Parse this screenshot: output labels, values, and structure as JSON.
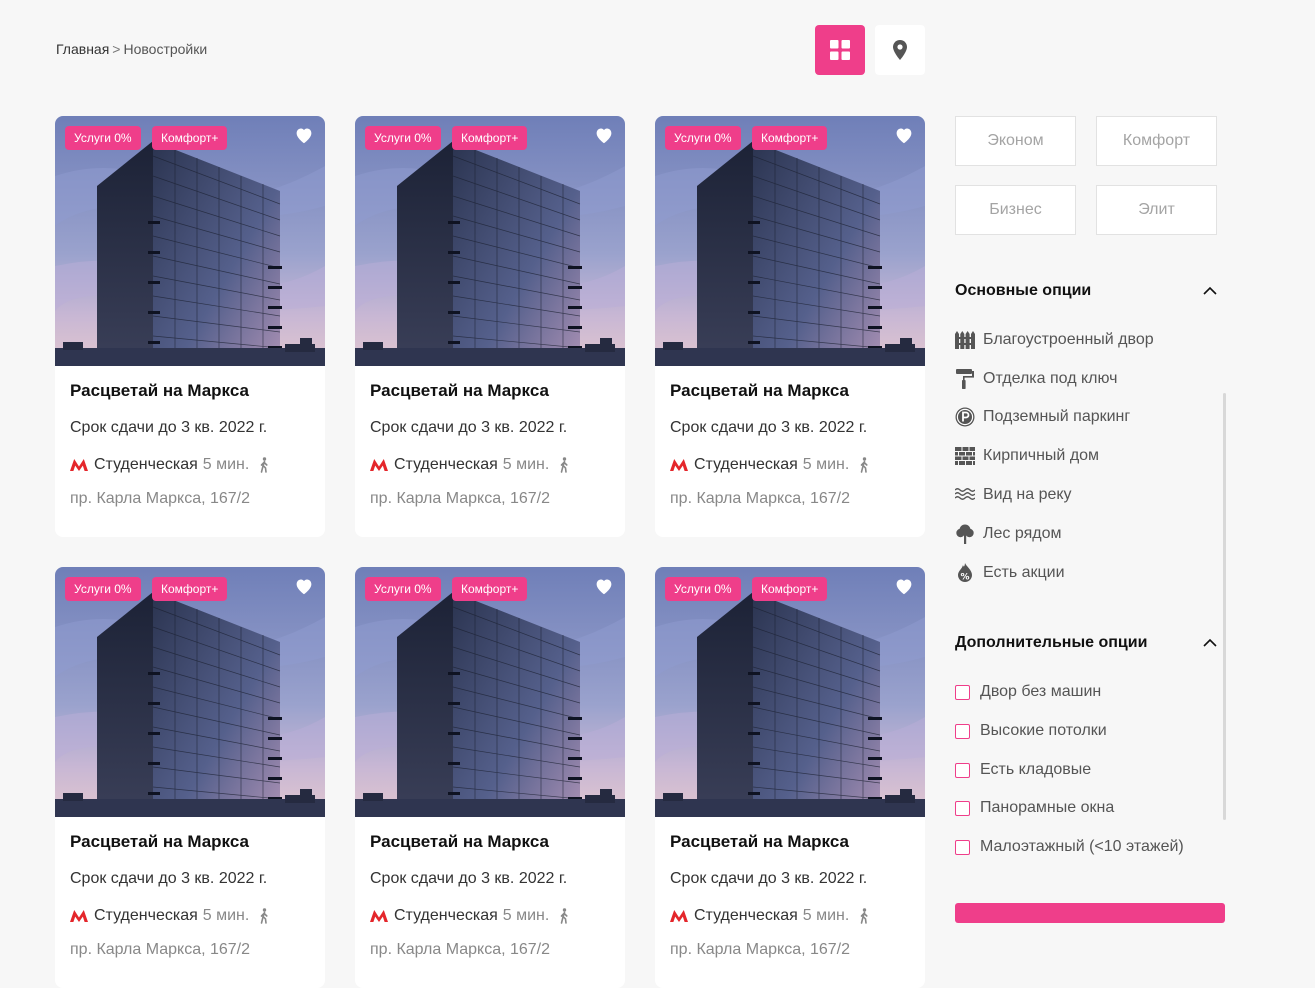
{
  "breadcrumb": {
    "home": "Главная",
    "separator": ">",
    "current": "Новостройки"
  },
  "view_toggle": {
    "grid_icon": "grid-icon",
    "map_icon": "map-pin-icon"
  },
  "colors": {
    "accent": "#ef3e8a",
    "metro": "#e4262b"
  },
  "cards": [
    {
      "tags": [
        "Услуги 0%",
        "Комфорт+"
      ],
      "title": "Расцветай на Маркса",
      "deadline": "Срок сдачи до 3 кв. 2022 г.",
      "metro": "Студенческая",
      "metro_time": "5 мин.",
      "address": "пр. Карла Маркса, 167/2"
    },
    {
      "tags": [
        "Услуги 0%",
        "Комфорт+"
      ],
      "title": "Расцветай на Маркса",
      "deadline": "Срок сдачи до 3 кв. 2022 г.",
      "metro": "Студенческая",
      "metro_time": "5 мин.",
      "address": "пр. Карла Маркса, 167/2"
    },
    {
      "tags": [
        "Услуги 0%",
        "Комфорт+"
      ],
      "title": "Расцветай на Маркса",
      "deadline": "Срок сдачи до 3 кв. 2022 г.",
      "metro": "Студенческая",
      "metro_time": "5 мин.",
      "address": "пр. Карла Маркса, 167/2"
    },
    {
      "tags": [
        "Услуги 0%",
        "Комфорт+"
      ],
      "title": "Расцветай на Маркса",
      "deadline": "Срок сдачи до 3 кв. 2022 г.",
      "metro": "Студенческая",
      "metro_time": "5 мин.",
      "address": "пр. Карла Маркса, 167/2"
    },
    {
      "tags": [
        "Услуги 0%",
        "Комфорт+"
      ],
      "title": "Расцветай на Маркса",
      "deadline": "Срок сдачи до 3 кв. 2022 г.",
      "metro": "Студенческая",
      "metro_time": "5 мин.",
      "address": "пр. Карла Маркса, 167/2"
    },
    {
      "tags": [
        "Услуги 0%",
        "Комфорт+"
      ],
      "title": "Расцветай на Маркса",
      "deadline": "Срок сдачи до 3 кв. 2022 г.",
      "metro": "Студенческая",
      "metro_time": "5 мин.",
      "address": "пр. Карла Маркса, 167/2"
    }
  ],
  "filters": {
    "classes": [
      "Эконом",
      "Комфорт",
      "Бизнес",
      "Элит"
    ],
    "main_options": {
      "title": "Основные опции",
      "items": [
        {
          "label": "Благоустроенный двор",
          "icon": "fence-icon"
        },
        {
          "label": "Отделка под ключ",
          "icon": "paint-roller-icon"
        },
        {
          "label": "Подземный паркинг",
          "icon": "parking-icon"
        },
        {
          "label": "Кирпичный дом",
          "icon": "brick-icon"
        },
        {
          "label": "Вид на реку",
          "icon": "waves-icon"
        },
        {
          "label": "Лес рядом",
          "icon": "tree-icon"
        },
        {
          "label": "Есть акции",
          "icon": "discount-icon"
        }
      ]
    },
    "extra_options": {
      "title": "Дополнительные опции",
      "items": [
        "Двор без машин",
        "Высокие потолки",
        "Есть кладовые",
        "Панорамные окна",
        "Малоэтажный (<10 этажей)"
      ]
    }
  }
}
